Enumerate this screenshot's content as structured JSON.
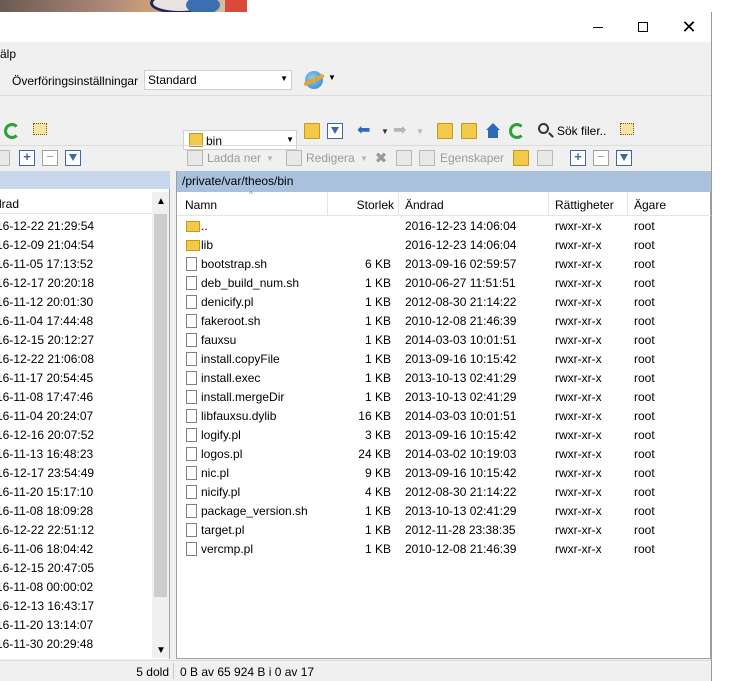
{
  "window": {
    "controls": {
      "minimize": "–",
      "maximize": "□",
      "close": "✕"
    }
  },
  "menu": {
    "help_label": "älp"
  },
  "transfer": {
    "label": "Överföringsinställningar",
    "preset": "Standard"
  },
  "toolbar": {
    "path_value": "bin",
    "find_label": "Sök filer..",
    "download_label": "Ladda ner",
    "edit_label": "Redigera",
    "properties_label": "Egenskaper"
  },
  "left_panel": {
    "column_changed": "drad",
    "rows": [
      "16-12-22 21:29:54",
      "16-12-09 21:04:54",
      "16-11-05 17:13:52",
      "16-12-17 20:20:18",
      "16-11-12 20:01:30",
      "16-11-04 17:44:48",
      "16-12-15 20:12:27",
      "16-12-22 21:06:08",
      "16-11-17 20:54:45",
      "16-11-08 17:47:46",
      "16-11-04 20:24:07",
      "16-12-16 20:07:52",
      "16-11-13 16:48:23",
      "16-12-17 23:54:49",
      "16-11-20 15:17:10",
      "16-11-08 18:09:28",
      "16-12-22 22:51:12",
      "16-11-06 18:04:42",
      "16-12-15 20:47:05",
      "16-11-08 00:00:02",
      "16-12-13 16:43:17",
      "16-11-20 13:14:07",
      "16-11-30 20:29:48"
    ],
    "status": "5 dold"
  },
  "right_panel": {
    "path": "/private/var/theos/bin",
    "columns": {
      "name": "Namn",
      "size": "Storlek",
      "changed": "Ändrad",
      "rights": "Rättigheter",
      "owner": "Ägare"
    },
    "files": [
      {
        "type": "up",
        "name": "..",
        "size": "",
        "changed": "2016-12-23 14:06:04",
        "rights": "rwxr-xr-x",
        "owner": "root"
      },
      {
        "type": "folder",
        "name": "lib",
        "size": "",
        "changed": "2016-12-23 14:06:04",
        "rights": "rwxr-xr-x",
        "owner": "root"
      },
      {
        "type": "file",
        "name": "bootstrap.sh",
        "size": "6 KB",
        "changed": "2013-09-16 02:59:57",
        "rights": "rwxr-xr-x",
        "owner": "root"
      },
      {
        "type": "file",
        "name": "deb_build_num.sh",
        "size": "1 KB",
        "changed": "2010-06-27 11:51:51",
        "rights": "rwxr-xr-x",
        "owner": "root"
      },
      {
        "type": "file",
        "name": "denicify.pl",
        "size": "1 KB",
        "changed": "2012-08-30 21:14:22",
        "rights": "rwxr-xr-x",
        "owner": "root"
      },
      {
        "type": "file",
        "name": "fakeroot.sh",
        "size": "1 KB",
        "changed": "2010-12-08 21:46:39",
        "rights": "rwxr-xr-x",
        "owner": "root"
      },
      {
        "type": "file",
        "name": "fauxsu",
        "size": "1 KB",
        "changed": "2014-03-03 10:01:51",
        "rights": "rwxr-xr-x",
        "owner": "root"
      },
      {
        "type": "file",
        "name": "install.copyFile",
        "size": "1 KB",
        "changed": "2013-09-16 10:15:42",
        "rights": "rwxr-xr-x",
        "owner": "root"
      },
      {
        "type": "file",
        "name": "install.exec",
        "size": "1 KB",
        "changed": "2013-10-13 02:41:29",
        "rights": "rwxr-xr-x",
        "owner": "root"
      },
      {
        "type": "file",
        "name": "install.mergeDir",
        "size": "1 KB",
        "changed": "2013-10-13 02:41:29",
        "rights": "rwxr-xr-x",
        "owner": "root"
      },
      {
        "type": "file",
        "name": "libfauxsu.dylib",
        "size": "16 KB",
        "changed": "2014-03-03 10:01:51",
        "rights": "rwxr-xr-x",
        "owner": "root"
      },
      {
        "type": "file",
        "name": "logify.pl",
        "size": "3 KB",
        "changed": "2013-09-16 10:15:42",
        "rights": "rwxr-xr-x",
        "owner": "root"
      },
      {
        "type": "file",
        "name": "logos.pl",
        "size": "24 KB",
        "changed": "2014-03-02 10:19:03",
        "rights": "rwxr-xr-x",
        "owner": "root"
      },
      {
        "type": "file",
        "name": "nic.pl",
        "size": "9 KB",
        "changed": "2013-09-16 10:15:42",
        "rights": "rwxr-xr-x",
        "owner": "root"
      },
      {
        "type": "file",
        "name": "nicify.pl",
        "size": "4 KB",
        "changed": "2012-08-30 21:14:22",
        "rights": "rwxr-xr-x",
        "owner": "root"
      },
      {
        "type": "file",
        "name": "package_version.sh",
        "size": "1 KB",
        "changed": "2013-10-13 02:41:29",
        "rights": "rwxr-xr-x",
        "owner": "root"
      },
      {
        "type": "file",
        "name": "target.pl",
        "size": "1 KB",
        "changed": "2012-11-28 23:38:35",
        "rights": "rwxr-xr-x",
        "owner": "root"
      },
      {
        "type": "file",
        "name": "vercmp.pl",
        "size": "1 KB",
        "changed": "2010-12-08 21:46:39",
        "rights": "rwxr-xr-x",
        "owner": "root"
      }
    ],
    "status": "0 B av 65 924 B i 0 av 17"
  },
  "colors": {
    "panel_header_active": "#a9c1dd",
    "panel_header_inactive": "#c7d6ea",
    "folder": "#f3c94a",
    "refresh_green": "#2aa336",
    "nav_blue": "#2d6bb8"
  }
}
